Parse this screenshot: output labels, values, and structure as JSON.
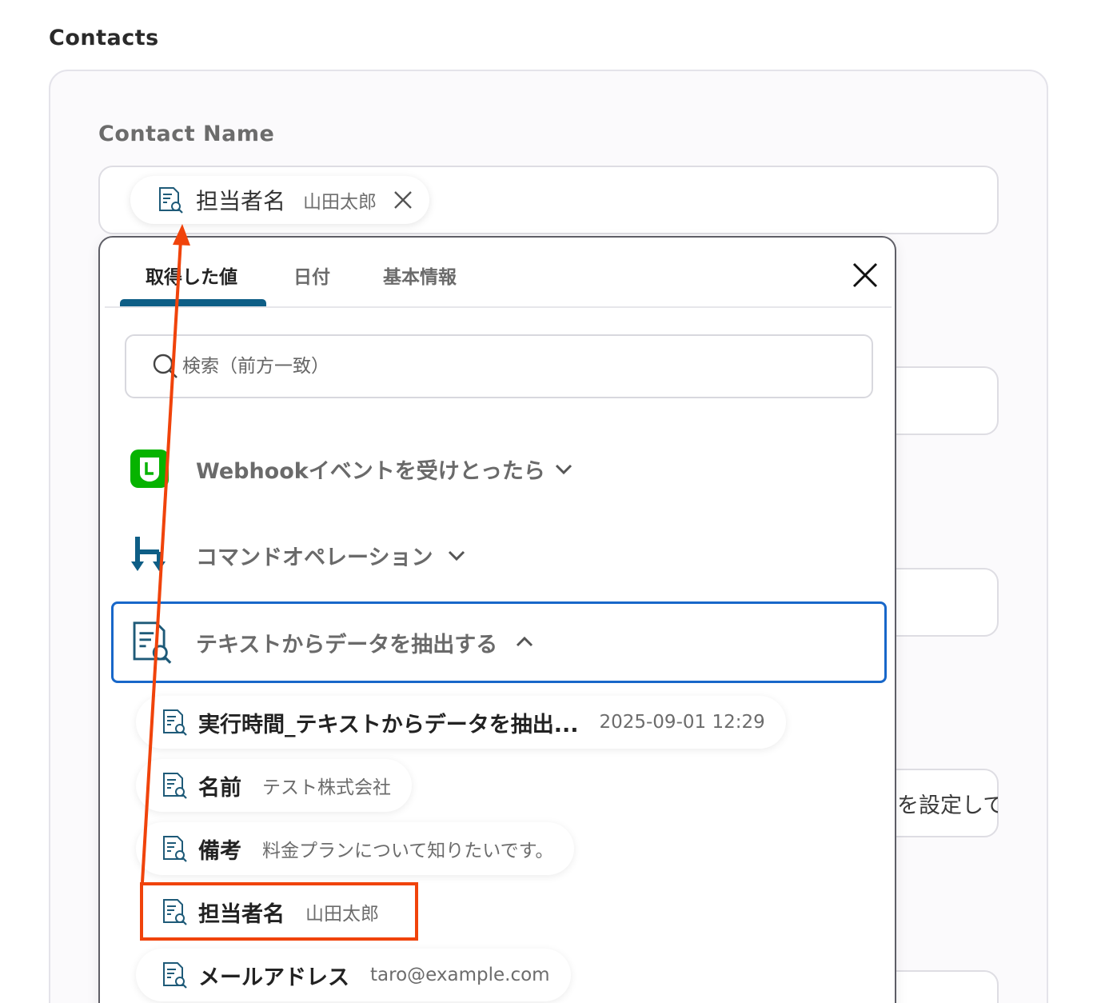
{
  "section_title": "Contacts",
  "field": {
    "label": "Contact Name",
    "chip": {
      "icon": "document-search-icon",
      "key": "担当者名",
      "value": "山田太郎"
    },
    "peek_text": "を設定して"
  },
  "dropdown": {
    "tabs": [
      {
        "label": "取得した値",
        "active": true
      },
      {
        "label": "日付",
        "active": false
      },
      {
        "label": "基本情報",
        "active": false
      }
    ],
    "search_placeholder": "検索（前方一致）",
    "groups": [
      {
        "label": "Webhookイベントを受けとったら",
        "icon": "line-app-icon",
        "expanded": false
      },
      {
        "label": "コマンドオペレーション",
        "icon": "command-operation-icon",
        "expanded": false
      },
      {
        "label": "テキストからデータを抽出する",
        "icon": "document-search-icon",
        "expanded": true
      }
    ],
    "items": [
      {
        "key": "実行時間_テキストからデータを抽出...",
        "value": "2025-09-01 12:29"
      },
      {
        "key": "名前",
        "value": "テスト株式会社"
      },
      {
        "key": "備考",
        "value": "料金プランについて知りたいです。"
      },
      {
        "key": "担当者名",
        "value": "山田太郎",
        "highlighted": true
      },
      {
        "key": "メールアドレス",
        "value": "taro@example.com"
      }
    ]
  },
  "colors": {
    "accent_tab": "#0e5e86",
    "selected_border": "#1867c9",
    "annotation": "#f0430b",
    "line_green": "#06b300"
  }
}
